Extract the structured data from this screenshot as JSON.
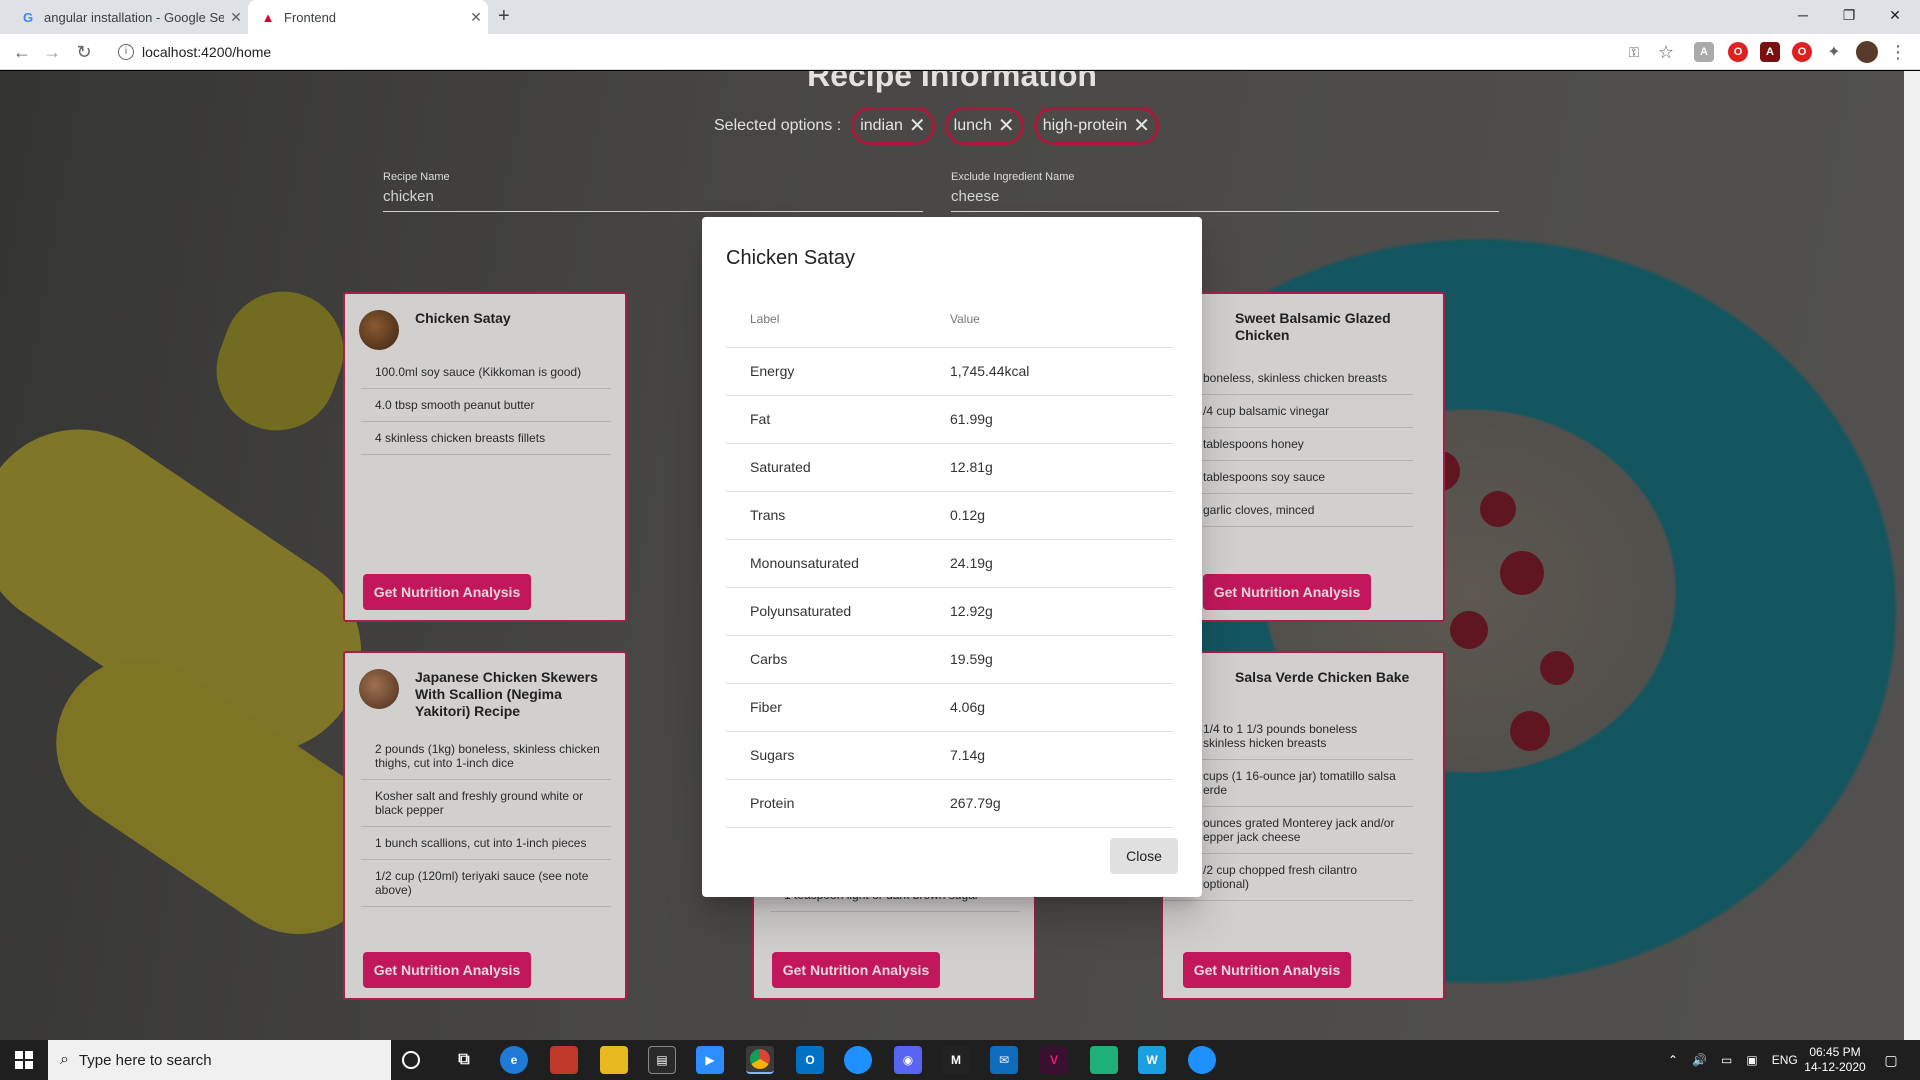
{
  "browser": {
    "tabs": [
      {
        "title": "angular installation - Google Sea",
        "icon": "google-icon"
      },
      {
        "title": "Frontend",
        "icon": "angular-icon"
      }
    ],
    "url": "localhost:4200/home"
  },
  "page": {
    "title": "Recipe Information",
    "selected_label": "Selected options :",
    "chips": [
      "indian",
      "lunch",
      "high-protein"
    ],
    "recipe_name_label": "Recipe Name",
    "recipe_name_value": "chicken",
    "exclude_label": "Exclude Ingredient Name",
    "exclude_value": "cheese",
    "button_label": "Get Nutrition Analysis",
    "cards": [
      {
        "title": "Chicken Satay",
        "ingredients": [
          "100.0ml soy sauce (Kikkoman is good)",
          "4.0 tbsp smooth peanut butter",
          "4 skinless chicken breasts fillets"
        ]
      },
      {
        "title": "Sweet Balsamic Glazed Chicken",
        "ingredients": [
          "boneless, skinless chicken breasts",
          "/4 cup balsamic vinegar",
          "tablespoons honey",
          "tablespoons soy sauce",
          "garlic cloves, minced"
        ]
      },
      {
        "title": "Japanese Chicken Skewers With Scallion (Negima Yakitori) Recipe",
        "ingredients": [
          "2 pounds (1kg) boneless, skinless chicken thighs, cut into 1-inch dice",
          "Kosher salt and freshly ground white or black pepper",
          "1 bunch scallions, cut into 1-inch pieces",
          "1/2 cup (120ml) teriyaki sauce (see note above)"
        ]
      },
      {
        "title": "",
        "ingredients": [
          "1 teaspoon light or dark brown sugar"
        ]
      },
      {
        "title": "Salsa Verde Chicken Bake",
        "ingredients": [
          "1/4 to 1 1/3 pounds boneless skinless hicken breasts",
          "cups (1 16-ounce jar) tomatillo salsa erde",
          "ounces grated Monterey jack and/or epper jack cheese",
          "/2 cup chopped fresh cilantro optional)"
        ]
      }
    ]
  },
  "dialog": {
    "title": "Chicken Satay",
    "col_label": "Label",
    "col_value": "Value",
    "rows": [
      {
        "label": "Energy",
        "value": "1,745.44kcal"
      },
      {
        "label": "Fat",
        "value": "61.99g"
      },
      {
        "label": "Saturated",
        "value": "12.81g"
      },
      {
        "label": "Trans",
        "value": "0.12g"
      },
      {
        "label": "Monounsaturated",
        "value": "24.19g"
      },
      {
        "label": "Polyunsaturated",
        "value": "12.92g"
      },
      {
        "label": "Carbs",
        "value": "19.59g"
      },
      {
        "label": "Fiber",
        "value": "4.06g"
      },
      {
        "label": "Sugars",
        "value": "7.14g"
      },
      {
        "label": "Protein",
        "value": "267.79g"
      }
    ],
    "close_label": "Close"
  },
  "taskbar": {
    "search_placeholder": "Type here to search",
    "lang": "ENG",
    "time": "06:45 PM",
    "date": "14-12-2020"
  },
  "colors": {
    "accent": "#c2185b",
    "chip_border": "#a8193c",
    "card_border": "#a81e48"
  }
}
